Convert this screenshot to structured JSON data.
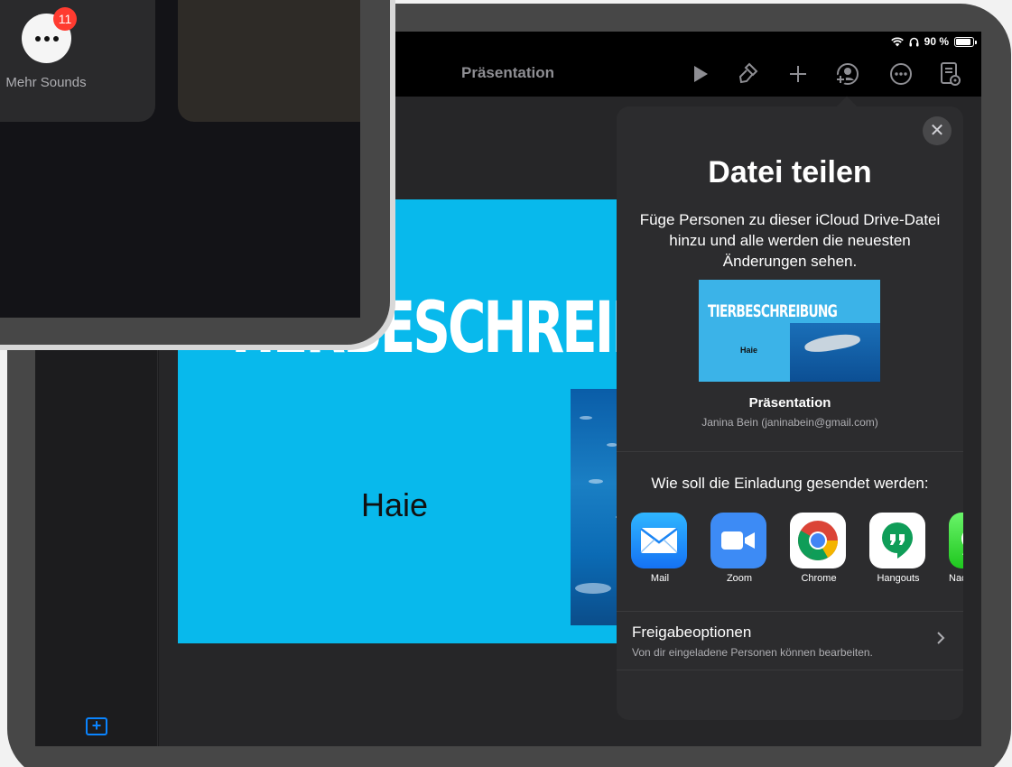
{
  "status_bar": {
    "battery": "90 %",
    "battery_level": 0.9
  },
  "toolbar": {
    "title": "Präsentation"
  },
  "slide": {
    "title": "TIERBESCHREIBUNG",
    "subtitle": "Haie"
  },
  "share_popover": {
    "close_icon": "✕",
    "title": "Datei teilen",
    "description": "Füge Personen zu dieser iCloud Drive-Datei hinzu und alle werden die neuesten Änderungen sehen.",
    "thumbnail": {
      "title": "TIERBESCHREIBUNG",
      "subtitle": "Haie"
    },
    "file_name": "Präsentation",
    "owner": "Janina Bein (janinabein@gmail.com)",
    "send_prompt": "Wie soll die Einladung gesendet werden:",
    "apps": [
      {
        "label": "Mail",
        "icon": "mail-icon"
      },
      {
        "label": "Zoom",
        "icon": "zoom-icon"
      },
      {
        "label": "Chrome",
        "icon": "chrome-icon"
      },
      {
        "label": "Hangouts",
        "icon": "hangouts-icon"
      },
      {
        "label": "Nac",
        "icon": "messages-icon"
      }
    ],
    "options": {
      "title": "Freigabeoptionen",
      "subtitle": "Von dir eingeladene Personen können bearbeiten."
    }
  },
  "overlay_ipad": {
    "more_label": "Mehr Sounds",
    "badge": "11"
  },
  "colors": {
    "accent": "#0a84ff",
    "slide_bg": "#08b9ec",
    "badge": "#ff3b30",
    "popover_bg": "#2c2c2e"
  }
}
